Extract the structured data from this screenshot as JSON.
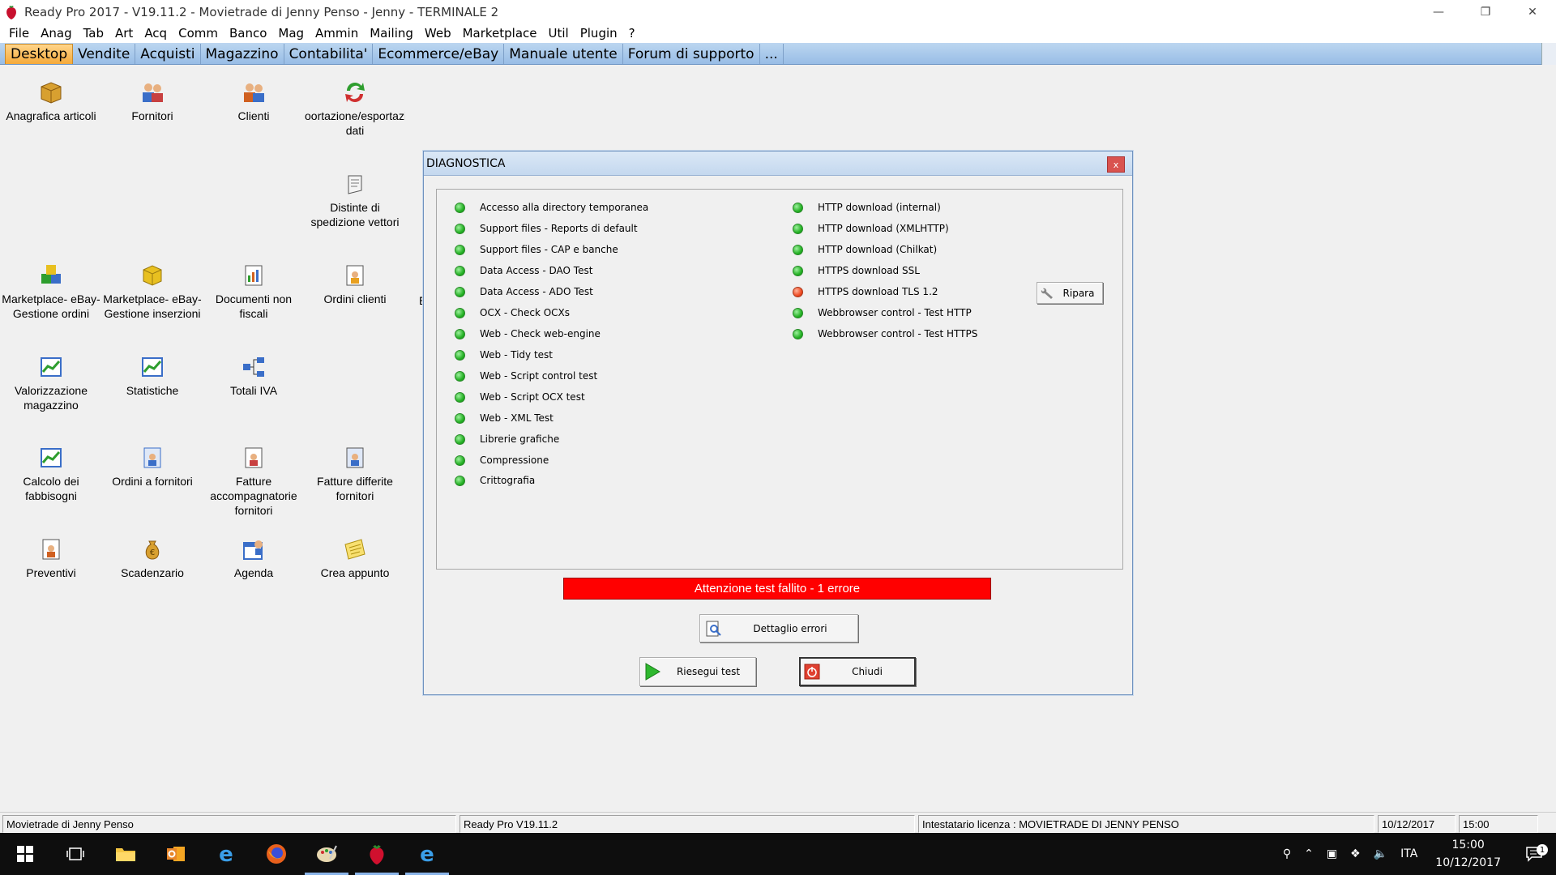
{
  "window": {
    "title": "Ready Pro 2017 - V19.11.2 - Movietrade di Jenny Penso - Jenny - TERMINALE 2"
  },
  "menu": [
    "File",
    "Anag",
    "Tab",
    "Art",
    "Acq",
    "Comm",
    "Banco",
    "Mag",
    "Ammin",
    "Mailing",
    "Web",
    "Marketplace",
    "Util",
    "Plugin",
    "?"
  ],
  "tabs": [
    {
      "label": "Desktop",
      "active": true
    },
    {
      "label": "Vendite"
    },
    {
      "label": "Acquisti"
    },
    {
      "label": "Magazzino"
    },
    {
      "label": "Contabilita'"
    },
    {
      "label": "Ecommerce/eBay"
    },
    {
      "label": "Manuale utente"
    },
    {
      "label": "Forum di supporto"
    },
    {
      "label": "..."
    }
  ],
  "desktop": {
    "anagrafica": "Anagrafica articoli",
    "fornitori": "Fornitori",
    "clienti": "Clienti",
    "import_line1": "oortazione/esportazio",
    "import_line2": "dati",
    "distinte_line1": "Distinte di",
    "distinte_line2": "spedizione vettori",
    "mp_ordini_line1": "Marketplace- eBay-",
    "mp_ordini_line2": "Gestione ordini",
    "mp_inserzioni_line1": "Marketplace- eBay-",
    "mp_inserzioni_line2": "Gestione inserzioni",
    "documenti_line1": "Documenti non",
    "documenti_line2": "fiscali",
    "ordini_clienti": "Ordini clienti",
    "cut_label": "E",
    "valorizzazione_line1": "Valorizzazione",
    "valorizzazione_line2": "magazzino",
    "statistiche": "Statistiche",
    "totali_iva": "Totali IVA",
    "calcolo_line1": "Calcolo dei",
    "calcolo_line2": "fabbisogni",
    "ordini_fornitori": "Ordini a fornitori",
    "fatture_acc_line1": "Fatture",
    "fatture_acc_line2": "accompagnatorie",
    "fatture_acc_line3": "fornitori",
    "fatture_diff_line1": "Fatture differite",
    "fatture_diff_line2": "fornitori",
    "preventivi": "Preventivi",
    "scadenzario": "Scadenzario",
    "agenda": "Agenda",
    "crea_appunto": "Crea appunto"
  },
  "dialog": {
    "title": "DIAGNOSTICA",
    "close": "x",
    "checks_left": [
      {
        "label": "Accesso alla directory temporanea",
        "status": "ok"
      },
      {
        "label": "Support files - Reports di default",
        "status": "ok"
      },
      {
        "label": "Support files - CAP e banche",
        "status": "ok"
      },
      {
        "label": "Data Access - DAO Test",
        "status": "ok"
      },
      {
        "label": "Data Access - ADO Test",
        "status": "ok"
      },
      {
        "label": "OCX - Check OCXs",
        "status": "ok"
      },
      {
        "label": "Web - Check web-engine",
        "status": "ok"
      },
      {
        "label": "Web - Tidy test",
        "status": "ok"
      },
      {
        "label": "Web - Script control test",
        "status": "ok"
      },
      {
        "label": "Web - Script OCX test",
        "status": "ok"
      },
      {
        "label": "Web - XML Test",
        "status": "ok"
      },
      {
        "label": "Librerie grafiche",
        "status": "ok"
      },
      {
        "label": "Compressione",
        "status": "ok"
      },
      {
        "label": "Crittografia",
        "status": "ok"
      }
    ],
    "checks_right": [
      {
        "label": "HTTP download (internal)",
        "status": "ok"
      },
      {
        "label": "HTTP download (XMLHTTP)",
        "status": "ok"
      },
      {
        "label": "HTTP download (Chilkat)",
        "status": "ok"
      },
      {
        "label": "HTTPS download SSL",
        "status": "ok"
      },
      {
        "label": "HTTPS download TLS 1.2",
        "status": "fail"
      },
      {
        "label": "Webbrowser control - Test HTTP",
        "status": "ok"
      },
      {
        "label": "Webbrowser control - Test HTTPS",
        "status": "ok"
      }
    ],
    "ripara": "Ripara",
    "error_message": "Attenzione test fallito - 1 errore",
    "dettaglio": "Dettaglio errori",
    "riesegui": "Riesegui test",
    "chiudi": "Chiudi"
  },
  "status": {
    "company": "Movietrade di Jenny Penso",
    "version": "Ready Pro V19.11.2",
    "license": "Intestatario licenza : MOVIETRADE DI JENNY PENSO",
    "date": "10/12/2017",
    "time": "15:00"
  },
  "taskbar": {
    "lang": "ITA",
    "clock_time": "15:00",
    "clock_date": "10/12/2017",
    "notifications": "1"
  },
  "colors": {
    "tab_active": "#f5a93a",
    "error_bar": "#ff0000",
    "ok": "#26b226",
    "fail": "#ef4b23"
  }
}
